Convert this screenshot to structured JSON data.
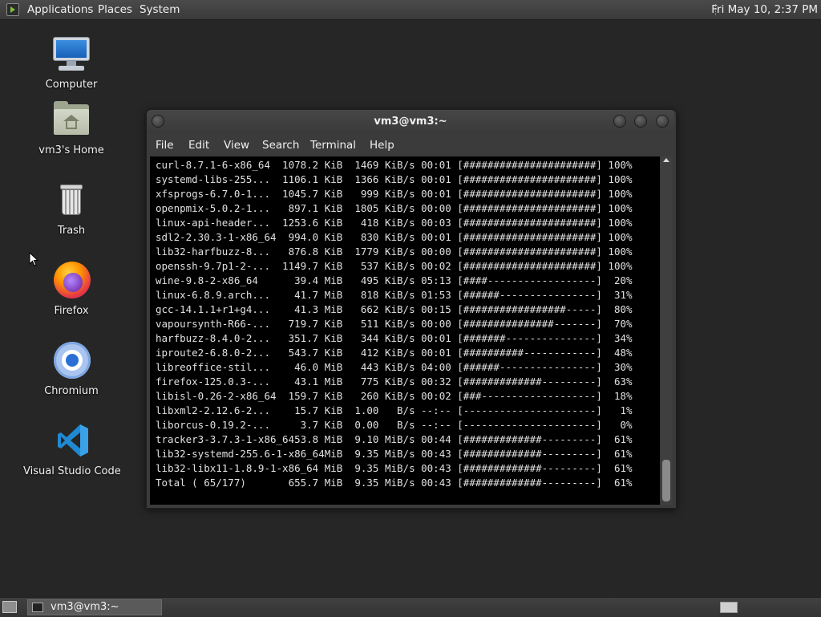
{
  "top_panel": {
    "menus": [
      "Applications",
      "Places",
      "System"
    ],
    "clock": "Fri May 10,  2:37 PM"
  },
  "desktop": {
    "icons": [
      {
        "label": "Computer",
        "icon": "computer-icon"
      },
      {
        "label": "vm3's Home",
        "icon": "home-folder-icon"
      },
      {
        "label": "Trash",
        "icon": "trash-icon"
      },
      {
        "label": "Firefox",
        "icon": "firefox-icon"
      },
      {
        "label": "Chromium",
        "icon": "chromium-icon"
      },
      {
        "label": "Visual Studio Code",
        "icon": "vscode-icon"
      }
    ]
  },
  "terminal": {
    "title": "vm3@vm3:~",
    "menu": [
      "File",
      "Edit",
      "View",
      "Search",
      "Terminal",
      "Help"
    ],
    "lines": [
      "curl-8.7.1-6-x86_64  1078.2 KiB  1469 KiB/s 00:01 [######################] 100%",
      "systemd-libs-255...  1106.1 KiB  1366 KiB/s 00:01 [######################] 100%",
      "xfsprogs-6.7.0-1...  1045.7 KiB   999 KiB/s 00:01 [######################] 100%",
      "openpmix-5.0.2-1...   897.1 KiB  1805 KiB/s 00:00 [######################] 100%",
      "linux-api-header...  1253.6 KiB   418 KiB/s 00:03 [######################] 100%",
      "sdl2-2.30.3-1-x86_64  994.0 KiB   830 KiB/s 00:01 [######################] 100%",
      "lib32-harfbuzz-8...   876.8 KiB  1779 KiB/s 00:00 [######################] 100%",
      "openssh-9.7p1-2-...  1149.7 KiB   537 KiB/s 00:02 [######################] 100%",
      "wine-9.8-2-x86_64      39.4 MiB   495 KiB/s 05:13 [####------------------]  20%",
      "linux-6.8.9.arch...    41.7 MiB   818 KiB/s 01:53 [######----------------]  31%",
      "gcc-14.1.1+r1+g4...    41.3 MiB   662 KiB/s 00:15 [#################-----]  80%",
      "vapoursynth-R66-...   719.7 KiB   511 KiB/s 00:00 [###############-------]  70%",
      "harfbuzz-8.4.0-2...   351.7 KiB   344 KiB/s 00:01 [#######---------------]  34%",
      "iproute2-6.8.0-2...   543.7 KiB   412 KiB/s 00:01 [##########------------]  48%",
      "libreoffice-stil...    46.0 MiB   443 KiB/s 04:00 [######----------------]  30%",
      "firefox-125.0.3-...    43.1 MiB   775 KiB/s 00:32 [#############---------]  63%",
      "libisl-0.26-2-x86_64  159.7 KiB   260 KiB/s 00:02 [###-------------------]  18%",
      "libxml2-2.12.6-2...    15.7 KiB  1.00   B/s --:-- [----------------------]   1%",
      "liborcus-0.19.2-...     3.7 KiB  0.00   B/s --:-- [----------------------]   0%",
      "tracker3-3.7.3-1-x86_6453.8 MiB  9.10 MiB/s 00:44 [#############---------]  61%",
      "lib32-systemd-255.6-1-x86_64MiB  9.35 MiB/s 00:43 [#############---------]  61%",
      "lib32-libx11-1.8.9-1-x86_64 MiB  9.35 MiB/s 00:43 [#############---------]  61%",
      "Total ( 65/177)       655.7 MiB  9.35 MiB/s 00:43 [#############---------]  61%"
    ]
  },
  "taskbar": {
    "task_label": "vm3@vm3:~"
  }
}
